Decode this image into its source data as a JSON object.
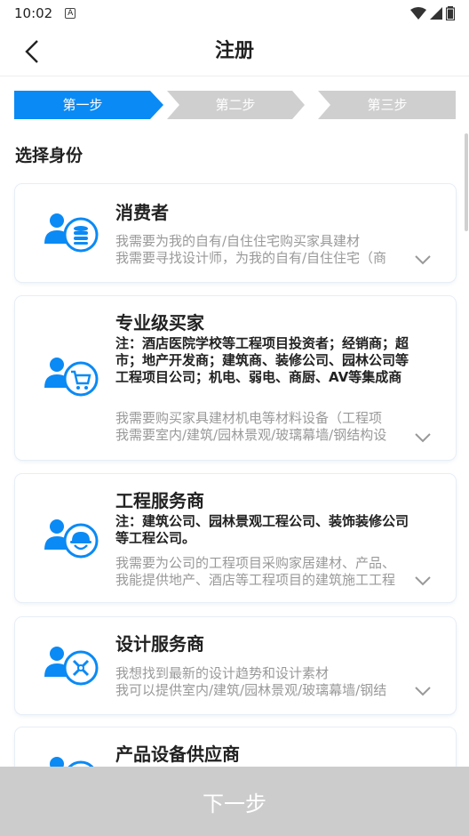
{
  "status": {
    "time": "10:02",
    "notif_letter": "A"
  },
  "nav": {
    "title": "注册"
  },
  "steps": [
    {
      "label": "第一步",
      "active": true
    },
    {
      "label": "第二步",
      "active": false
    },
    {
      "label": "第三步",
      "active": false
    }
  ],
  "colors": {
    "accent": "#0a8af5",
    "step_inactive": "#cfcfcf",
    "bottom_bar": "#cccccc"
  },
  "section_title": "选择身份",
  "cards": [
    {
      "title": "消费者",
      "note": "",
      "desc1": "我需要为我的自有/自住住宅购买家具建材",
      "desc2": "我需要寻找设计师，为我的自有/自住住宅（商",
      "icon": "consumer-coins-icon"
    },
    {
      "title": "专业级买家",
      "note": "注：酒店医院学校等工程项目投资者；经销商；超市；地产开发商；建筑商、装修公司、园林公司等工程项目公司；机电、弱电、商厨、AV等集成商",
      "desc1": "我需要购买家具建材机电等材料设备（工程项",
      "desc2": "我需要室内/建筑/园林景观/玻璃幕墙/钢结构设",
      "icon": "buyer-cart-icon"
    },
    {
      "title": "工程服务商",
      "note": "注：建筑公司、园林景观工程公司、装饰装修公司等工程公司。",
      "desc1": "我需要为公司的工程项目采购家居建材、产品、",
      "desc2": "我能提供地产、酒店等工程项目的建筑施工工程",
      "icon": "engineer-helmet-icon"
    },
    {
      "title": "设计服务商",
      "note": "",
      "desc1": "我想找到最新的设计趋势和设计素材",
      "desc2": "我可以提供室内/建筑/园林景观/玻璃幕墙/钢结",
      "icon": "designer-tools-icon"
    },
    {
      "title": "产品设备供应商",
      "note": "",
      "desc1": "",
      "desc2": "",
      "icon": "supplier-icon"
    }
  ],
  "next_button": "下一步"
}
